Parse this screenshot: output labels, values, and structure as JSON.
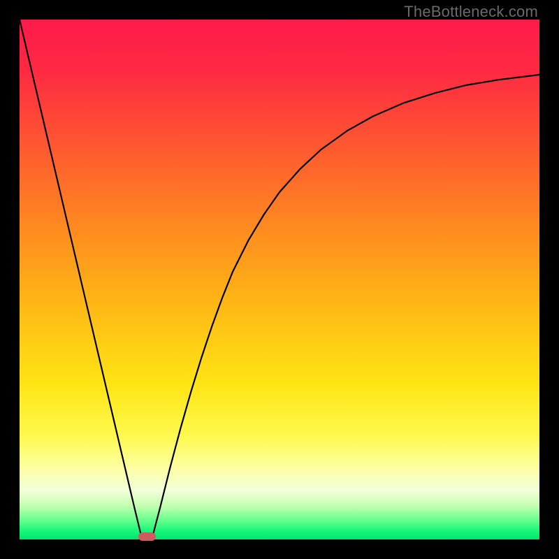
{
  "watermark": {
    "text": "TheBottleneck.com"
  },
  "chart_data": {
    "type": "line",
    "title": "",
    "xlabel": "",
    "ylabel": "",
    "xlim": [
      0,
      100
    ],
    "ylim": [
      0,
      100
    ],
    "gradient_stops": [
      {
        "offset": 0.0,
        "color": "#ff1a4b"
      },
      {
        "offset": 0.1,
        "color": "#ff2a42"
      },
      {
        "offset": 0.25,
        "color": "#ff5a2f"
      },
      {
        "offset": 0.4,
        "color": "#ff8a1f"
      },
      {
        "offset": 0.55,
        "color": "#ffb814"
      },
      {
        "offset": 0.7,
        "color": "#ffe413"
      },
      {
        "offset": 0.8,
        "color": "#fff94d"
      },
      {
        "offset": 0.86,
        "color": "#fdffa0"
      },
      {
        "offset": 0.905,
        "color": "#f3ffd8"
      },
      {
        "offset": 0.935,
        "color": "#c4ffb0"
      },
      {
        "offset": 0.965,
        "color": "#5eff8a"
      },
      {
        "offset": 0.985,
        "color": "#14f57a"
      },
      {
        "offset": 1.0,
        "color": "#05e36e"
      }
    ],
    "series": [
      {
        "name": "bottleneck-curve",
        "x": [
          0,
          2,
          4,
          6,
          8,
          10,
          12,
          14,
          16,
          18,
          20,
          22,
          23.5,
          25.5,
          27,
          29,
          31,
          33,
          35,
          37,
          39,
          41,
          44,
          47,
          50,
          54,
          58,
          63,
          68,
          74,
          80,
          86,
          92,
          100
        ],
        "values": [
          100.0,
          91.5,
          83.0,
          74.5,
          66.0,
          57.5,
          49.0,
          40.5,
          32.0,
          23.5,
          15.0,
          6.5,
          0.3,
          0.3,
          6.0,
          14.0,
          21.5,
          28.5,
          35.0,
          41.0,
          46.5,
          51.5,
          57.5,
          62.5,
          66.8,
          71.3,
          75.0,
          78.6,
          81.4,
          84.0,
          85.9,
          87.4,
          88.4,
          89.4
        ]
      }
    ],
    "marker": {
      "x": 24.5,
      "y": 0.5,
      "w": 3.4,
      "h": 1.6,
      "color": "#cf5b5e"
    },
    "tick_labels": [],
    "legend": []
  }
}
